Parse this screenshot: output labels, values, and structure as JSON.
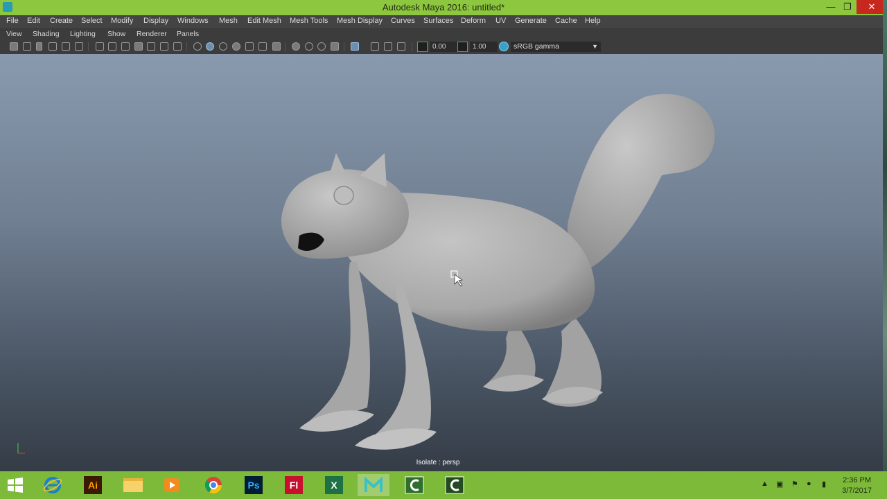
{
  "window": {
    "title": "Autodesk Maya 2016: untitled*"
  },
  "menu": [
    "File",
    "Edit",
    "Create",
    "Select",
    "Modify",
    "Display",
    "Windows",
    "Mesh",
    "Edit Mesh",
    "Mesh Tools",
    "Mesh Display",
    "Curves",
    "Surfaces",
    "Deform",
    "UV",
    "Generate",
    "Cache",
    "Help"
  ],
  "panel_menu": [
    "View",
    "Shading",
    "Lighting",
    "Show",
    "Renderer",
    "Panels"
  ],
  "toolbar": {
    "exposure": "0.00",
    "gamma": "1.00",
    "color_space": "sRGB gamma"
  },
  "viewport": {
    "hud_label": "Isolate : persp",
    "axis_y": "Y",
    "axis_x": "X"
  },
  "taskbar": {
    "apps": [
      "start",
      "internet-explorer",
      "illustrator",
      "file-explorer",
      "media-player",
      "chrome",
      "photoshop",
      "flash",
      "excel",
      "maya",
      "camtasia",
      "camtasia-2"
    ],
    "ai_label": "Ai",
    "ps_label": "Ps",
    "fl_label": "Fl",
    "xl_label": "X",
    "time": "2:36 PM",
    "date": "3/7/2017"
  },
  "colors": {
    "title_bar": "#8dc63f",
    "taskbar": "#7dba3a",
    "close": "#c7281e"
  }
}
